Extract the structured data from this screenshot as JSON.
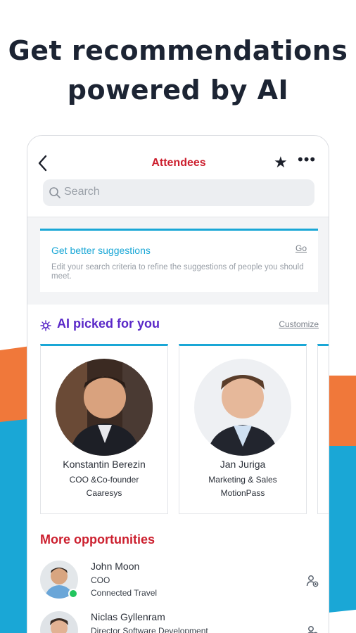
{
  "headline": {
    "line1": "Get recommendations",
    "line2": "powered by AI"
  },
  "header": {
    "title": "Attendees",
    "back_icon": "chevron-left-icon",
    "favorite_icon": "star-icon",
    "more_icon": "more-horizontal-icon"
  },
  "search": {
    "placeholder": "Search"
  },
  "suggestion_card": {
    "title": "Get better suggestions",
    "action": "Go",
    "body": "Edit your search criteria to refine the suggestions of people you should meet."
  },
  "ai_section": {
    "title": "AI picked for you",
    "action": "Customize",
    "people": [
      {
        "name": "Konstantin Berezin",
        "role": "COO &Co-founder",
        "company": "Caaresys"
      },
      {
        "name": "Jan Juriga",
        "role": "Marketing & Sales",
        "company": "MotionPass"
      }
    ]
  },
  "more_section": {
    "title": "More opportunities",
    "people": [
      {
        "name": "John Moon",
        "role": "COO",
        "company": "Connected Travel",
        "online": true
      },
      {
        "name": "Niclas Gyllenram",
        "role": "Director Software Development",
        "company": "",
        "online": false
      }
    ]
  },
  "colors": {
    "accent_red": "#cc1f2e",
    "accent_blue": "#1aa7d6",
    "accent_purple": "#5a28c8",
    "accent_orange": "#f0783a",
    "online_green": "#22c55e"
  }
}
